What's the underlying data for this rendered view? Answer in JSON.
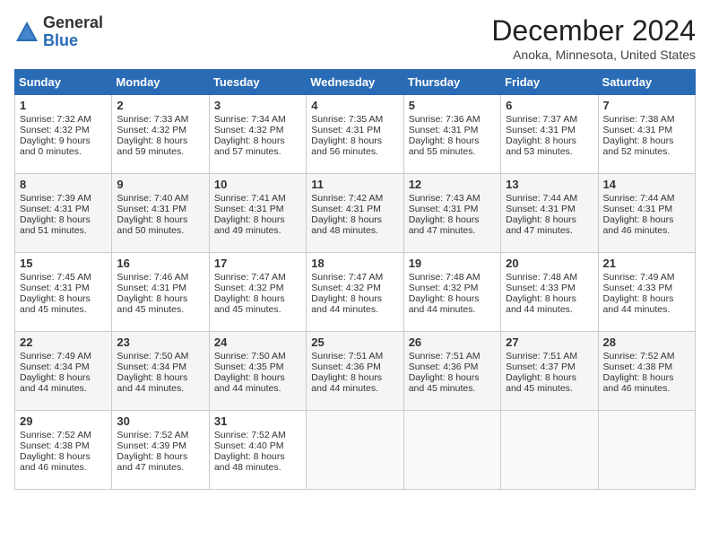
{
  "header": {
    "logo_general": "General",
    "logo_blue": "Blue",
    "month": "December 2024",
    "location": "Anoka, Minnesota, United States"
  },
  "days_of_week": [
    "Sunday",
    "Monday",
    "Tuesday",
    "Wednesday",
    "Thursday",
    "Friday",
    "Saturday"
  ],
  "weeks": [
    [
      {
        "day": "1",
        "sunrise": "7:32 AM",
        "sunset": "4:32 PM",
        "daylight": "9 hours and 0 minutes."
      },
      {
        "day": "2",
        "sunrise": "7:33 AM",
        "sunset": "4:32 PM",
        "daylight": "8 hours and 59 minutes."
      },
      {
        "day": "3",
        "sunrise": "7:34 AM",
        "sunset": "4:32 PM",
        "daylight": "8 hours and 57 minutes."
      },
      {
        "day": "4",
        "sunrise": "7:35 AM",
        "sunset": "4:31 PM",
        "daylight": "8 hours and 56 minutes."
      },
      {
        "day": "5",
        "sunrise": "7:36 AM",
        "sunset": "4:31 PM",
        "daylight": "8 hours and 55 minutes."
      },
      {
        "day": "6",
        "sunrise": "7:37 AM",
        "sunset": "4:31 PM",
        "daylight": "8 hours and 53 minutes."
      },
      {
        "day": "7",
        "sunrise": "7:38 AM",
        "sunset": "4:31 PM",
        "daylight": "8 hours and 52 minutes."
      }
    ],
    [
      {
        "day": "8",
        "sunrise": "7:39 AM",
        "sunset": "4:31 PM",
        "daylight": "8 hours and 51 minutes."
      },
      {
        "day": "9",
        "sunrise": "7:40 AM",
        "sunset": "4:31 PM",
        "daylight": "8 hours and 50 minutes."
      },
      {
        "day": "10",
        "sunrise": "7:41 AM",
        "sunset": "4:31 PM",
        "daylight": "8 hours and 49 minutes."
      },
      {
        "day": "11",
        "sunrise": "7:42 AM",
        "sunset": "4:31 PM",
        "daylight": "8 hours and 48 minutes."
      },
      {
        "day": "12",
        "sunrise": "7:43 AM",
        "sunset": "4:31 PM",
        "daylight": "8 hours and 47 minutes."
      },
      {
        "day": "13",
        "sunrise": "7:44 AM",
        "sunset": "4:31 PM",
        "daylight": "8 hours and 47 minutes."
      },
      {
        "day": "14",
        "sunrise": "7:44 AM",
        "sunset": "4:31 PM",
        "daylight": "8 hours and 46 minutes."
      }
    ],
    [
      {
        "day": "15",
        "sunrise": "7:45 AM",
        "sunset": "4:31 PM",
        "daylight": "8 hours and 45 minutes."
      },
      {
        "day": "16",
        "sunrise": "7:46 AM",
        "sunset": "4:31 PM",
        "daylight": "8 hours and 45 minutes."
      },
      {
        "day": "17",
        "sunrise": "7:47 AM",
        "sunset": "4:32 PM",
        "daylight": "8 hours and 45 minutes."
      },
      {
        "day": "18",
        "sunrise": "7:47 AM",
        "sunset": "4:32 PM",
        "daylight": "8 hours and 44 minutes."
      },
      {
        "day": "19",
        "sunrise": "7:48 AM",
        "sunset": "4:32 PM",
        "daylight": "8 hours and 44 minutes."
      },
      {
        "day": "20",
        "sunrise": "7:48 AM",
        "sunset": "4:33 PM",
        "daylight": "8 hours and 44 minutes."
      },
      {
        "day": "21",
        "sunrise": "7:49 AM",
        "sunset": "4:33 PM",
        "daylight": "8 hours and 44 minutes."
      }
    ],
    [
      {
        "day": "22",
        "sunrise": "7:49 AM",
        "sunset": "4:34 PM",
        "daylight": "8 hours and 44 minutes."
      },
      {
        "day": "23",
        "sunrise": "7:50 AM",
        "sunset": "4:34 PM",
        "daylight": "8 hours and 44 minutes."
      },
      {
        "day": "24",
        "sunrise": "7:50 AM",
        "sunset": "4:35 PM",
        "daylight": "8 hours and 44 minutes."
      },
      {
        "day": "25",
        "sunrise": "7:51 AM",
        "sunset": "4:36 PM",
        "daylight": "8 hours and 44 minutes."
      },
      {
        "day": "26",
        "sunrise": "7:51 AM",
        "sunset": "4:36 PM",
        "daylight": "8 hours and 45 minutes."
      },
      {
        "day": "27",
        "sunrise": "7:51 AM",
        "sunset": "4:37 PM",
        "daylight": "8 hours and 45 minutes."
      },
      {
        "day": "28",
        "sunrise": "7:52 AM",
        "sunset": "4:38 PM",
        "daylight": "8 hours and 46 minutes."
      }
    ],
    [
      {
        "day": "29",
        "sunrise": "7:52 AM",
        "sunset": "4:38 PM",
        "daylight": "8 hours and 46 minutes."
      },
      {
        "day": "30",
        "sunrise": "7:52 AM",
        "sunset": "4:39 PM",
        "daylight": "8 hours and 47 minutes."
      },
      {
        "day": "31",
        "sunrise": "7:52 AM",
        "sunset": "4:40 PM",
        "daylight": "8 hours and 48 minutes."
      },
      null,
      null,
      null,
      null
    ]
  ]
}
